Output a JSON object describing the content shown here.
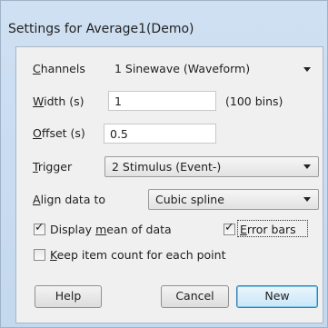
{
  "window": {
    "title": "Settings for Average1(Demo)"
  },
  "channels": {
    "label_u": "C",
    "label_rest": "hannels",
    "value": "1 Sinewave (Waveform)"
  },
  "width": {
    "label_u": "W",
    "label_rest": "idth (s)",
    "value": "1",
    "note": "(100 bins)"
  },
  "offset": {
    "label_u": "O",
    "label_rest": "ffset (s)",
    "value": "0.5"
  },
  "trigger": {
    "label_u": "T",
    "label_rest": "rigger",
    "value": "2 Stimulus (Event-)"
  },
  "align": {
    "label_u": "A",
    "label_rest": "lign data to",
    "value": "Cubic spline"
  },
  "display_mean": {
    "checked": true,
    "label_pre": "Display ",
    "label_u": "m",
    "label_post": "ean of data"
  },
  "error_bars": {
    "checked": true,
    "label_u": "E",
    "label_rest": "rror bars"
  },
  "keep_count": {
    "checked": false,
    "label_u": "K",
    "label_rest": "eep item count for each point"
  },
  "buttons": {
    "help": "Help",
    "cancel": "Cancel",
    "new": "New"
  },
  "glyphs": {
    "check": "✓"
  }
}
